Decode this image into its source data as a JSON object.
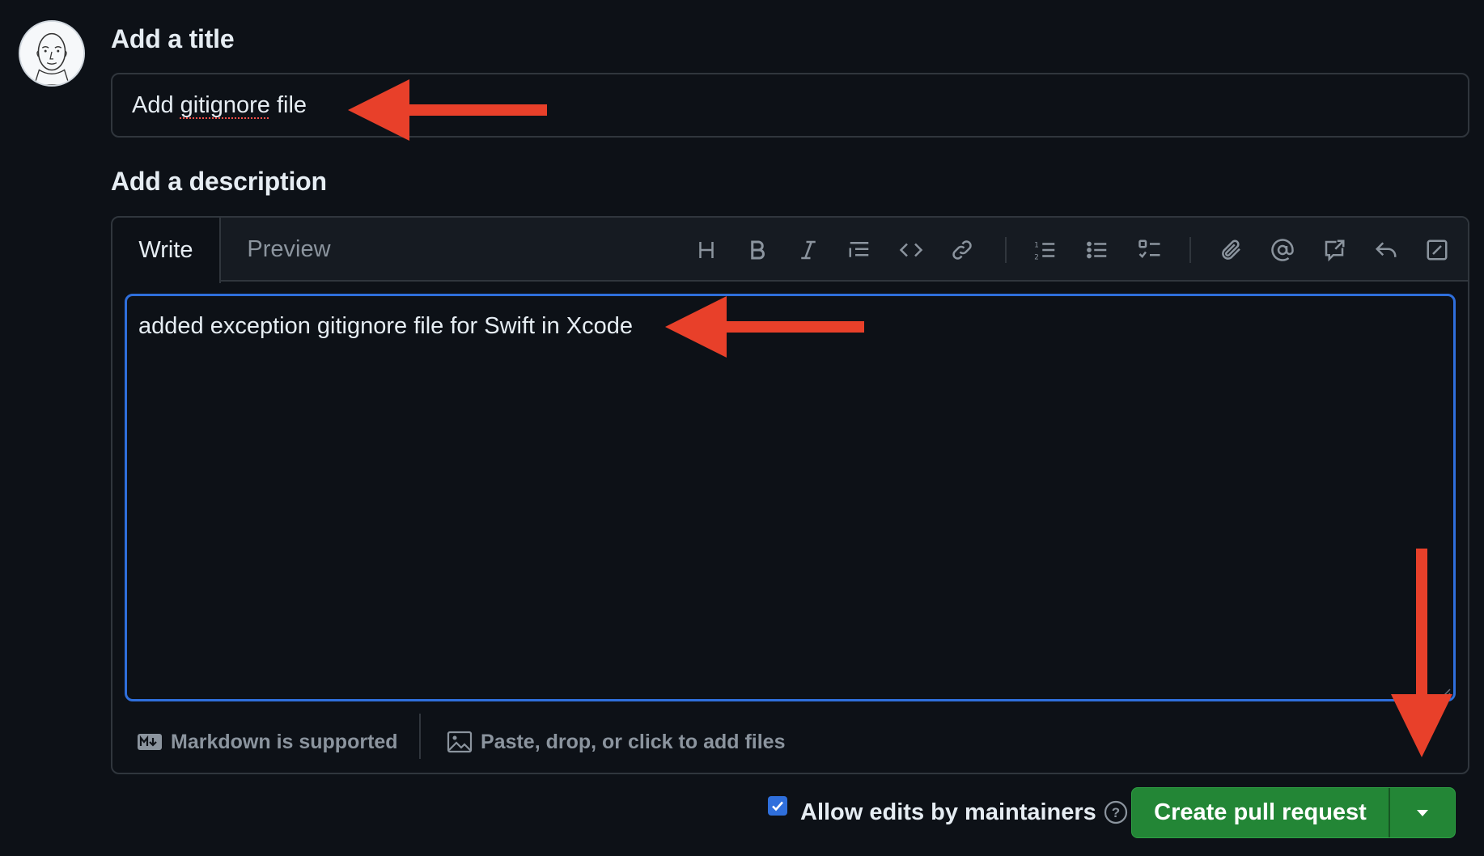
{
  "form": {
    "title_label": "Add a title",
    "title_value_prefix": "Add ",
    "title_value_misspelled": "gitignore",
    "title_value_suffix": " file",
    "description_label": "Add a description",
    "description_value": "added exception gitignore file for Swift in Xcode"
  },
  "editor": {
    "tabs": [
      {
        "label": "Write",
        "active": true
      },
      {
        "label": "Preview",
        "active": false
      }
    ],
    "toolbar_icons": [
      "heading-icon",
      "bold-icon",
      "italic-icon",
      "quote-icon",
      "code-icon",
      "link-icon",
      "ordered-list-icon",
      "unordered-list-icon",
      "task-list-icon",
      "attach-file-icon",
      "mention-icon",
      "reference-icon",
      "undo-reply-icon",
      "fullscreen-icon"
    ],
    "footer": {
      "markdown_label": "Markdown is supported",
      "attach_label": "Paste, drop, or click to add files"
    }
  },
  "actions": {
    "allow_edits_label": "Allow edits by maintainers",
    "allow_edits_checked": true,
    "create_button_label": "Create pull request"
  },
  "colors": {
    "background": "#0d1117",
    "focus_border": "#2f6fdc",
    "primary_button": "#238636",
    "annotation_arrow": "#e8402a"
  }
}
